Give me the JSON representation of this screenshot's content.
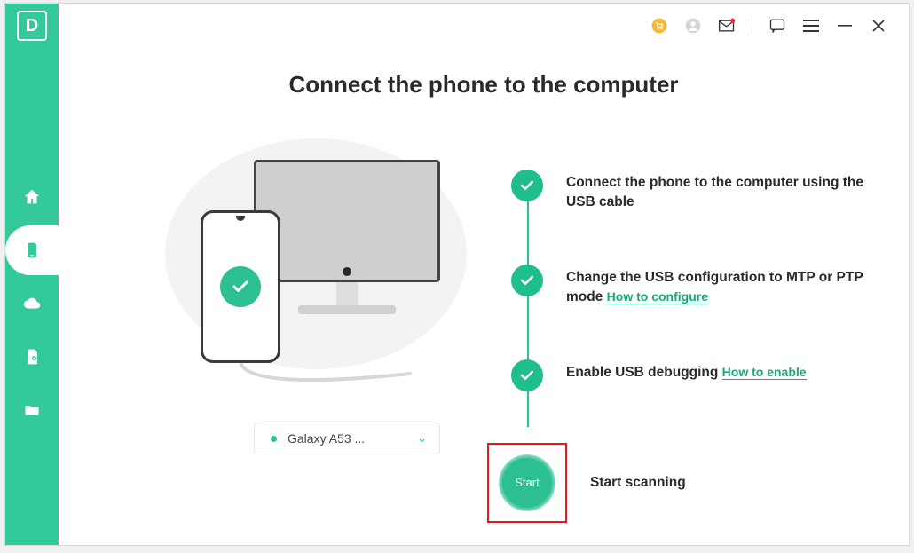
{
  "app": {
    "logo_letter": "D"
  },
  "titlebar": {
    "icons": [
      "cart-icon",
      "user-icon",
      "mail-icon",
      "feedback-icon",
      "menu-icon",
      "minimize-icon",
      "close-icon"
    ]
  },
  "sidebar": {
    "items": [
      {
        "name": "home-icon"
      },
      {
        "name": "phone-icon",
        "active": true
      },
      {
        "name": "cloud-icon"
      },
      {
        "name": "sdcard-icon"
      },
      {
        "name": "folder-icon"
      }
    ]
  },
  "page": {
    "title": "Connect the phone to the computer"
  },
  "device": {
    "name": "Galaxy A53 ..."
  },
  "steps": {
    "s1": "Connect the phone to the computer using the USB cable",
    "s2_a": "Change the USB configuration to MTP or PTP mode ",
    "s2_link": "How to configure",
    "s3_a": "Enable USB debugging ",
    "s3_link": "How to enable",
    "start_label": "Start",
    "start_text": "Start scanning"
  },
  "colors": {
    "accent": "#2bbf91",
    "sidebar": "#33c99a",
    "highlight": "#e21a1a",
    "link": "#1aa87b"
  }
}
